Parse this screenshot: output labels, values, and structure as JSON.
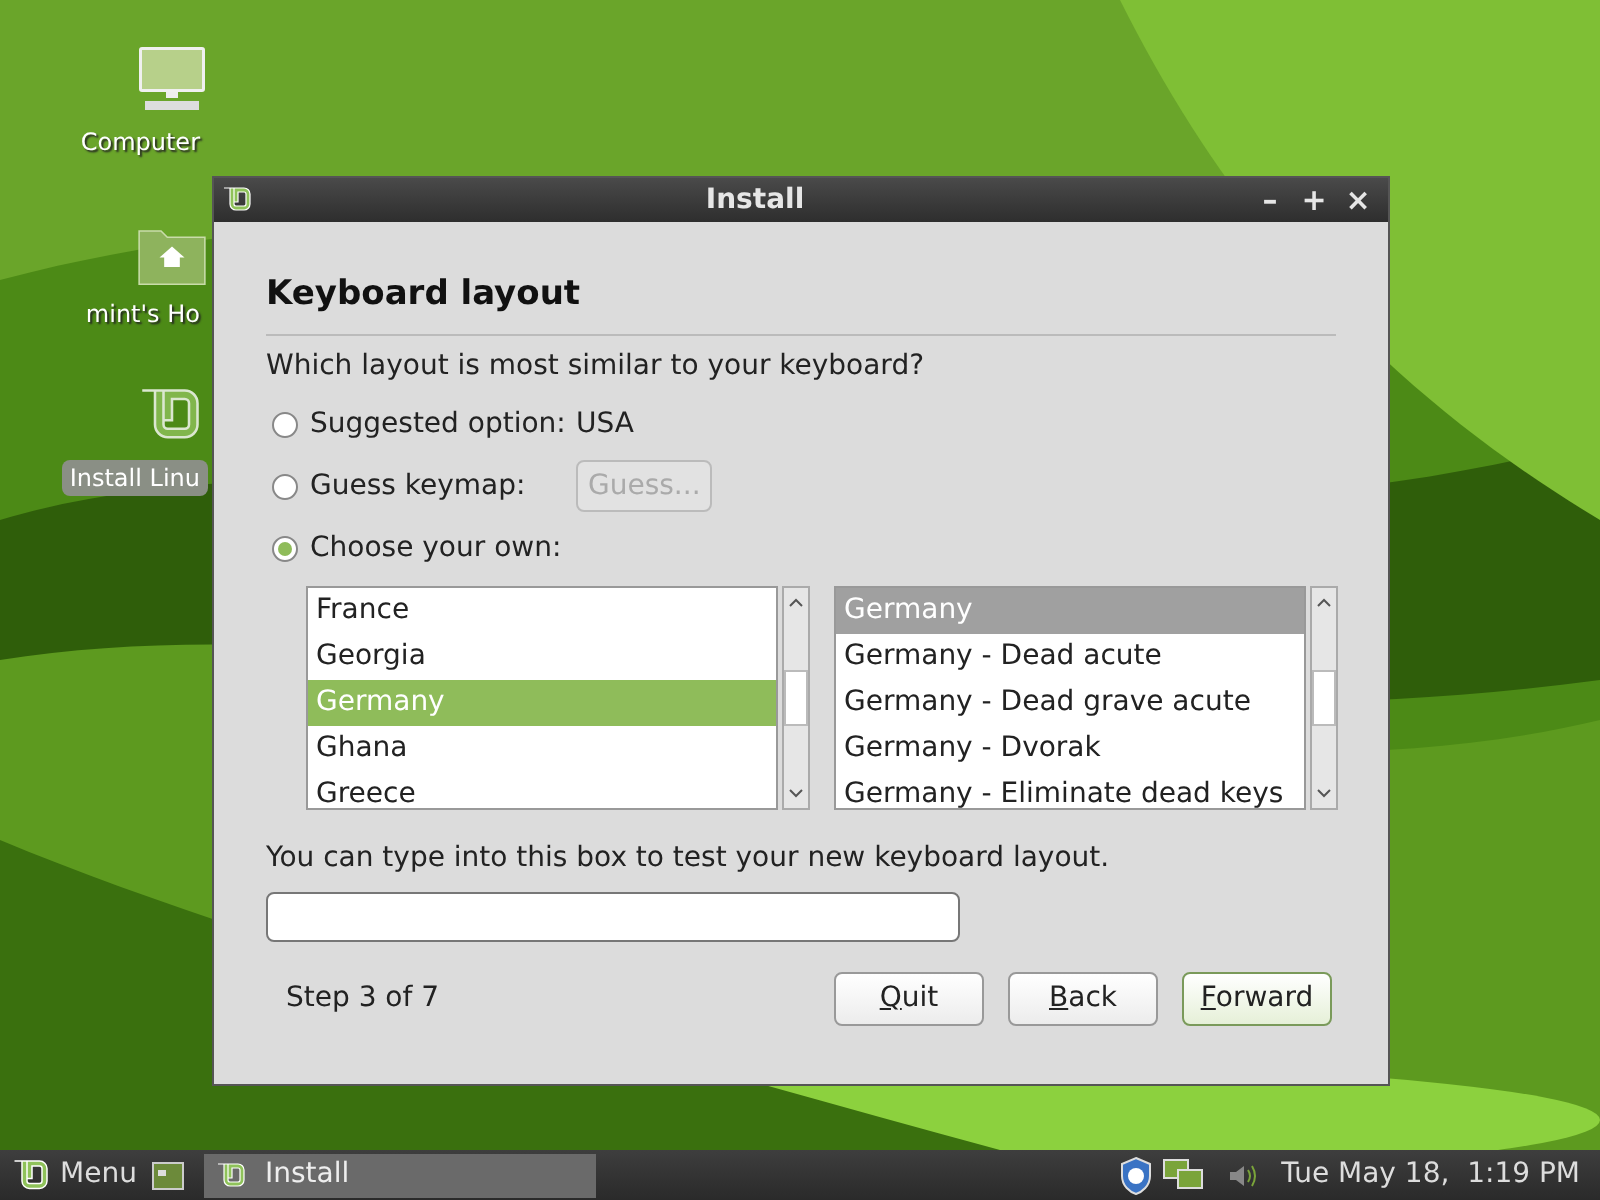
{
  "desktop_icons": [
    {
      "kind": "computer",
      "label": "Computer",
      "selected": false
    },
    {
      "kind": "home",
      "label": "mint's Ho",
      "selected": false
    },
    {
      "kind": "mint",
      "label": "Install Linu",
      "selected": true
    }
  ],
  "window": {
    "title": "Install",
    "controls": [
      "–",
      "+",
      "×"
    ]
  },
  "heading": "Keyboard layout",
  "question": "Which layout is most similar to your keyboard?",
  "options": [
    {
      "label": "Suggested option:",
      "kind": "value",
      "value": "USA",
      "selected": false
    },
    {
      "label": "Guess keymap:",
      "kind": "button",
      "button": "Guess...",
      "disabled": true,
      "selected": false
    },
    {
      "label": "Choose your own:",
      "kind": "plain",
      "selected": true
    }
  ],
  "layouts": {
    "items": [
      {
        "label": "France",
        "selected": false
      },
      {
        "label": "Georgia",
        "selected": false
      },
      {
        "label": "Germany",
        "selected": true
      },
      {
        "label": "Ghana",
        "selected": false
      },
      {
        "label": "Greece",
        "selected": false
      }
    ]
  },
  "variants": {
    "items": [
      {
        "label": "Germany",
        "selected": true
      },
      {
        "label": "Germany - Dead acute",
        "selected": false
      },
      {
        "label": "Germany - Dead grave acute",
        "selected": false
      },
      {
        "label": "Germany - Dvorak",
        "selected": false
      },
      {
        "label": "Germany - Eliminate dead keys",
        "selected": false
      }
    ]
  },
  "test_hint": "You can type into this box to test your new keyboard layout.",
  "step": "Step 3 of 7",
  "buttons": [
    {
      "label": "Quit",
      "default": false
    },
    {
      "label": "Back",
      "default": false
    },
    {
      "label": "Forward",
      "default": true
    }
  ],
  "taskbar": {
    "menu": "Menu",
    "tasks": [
      {
        "label": "Install",
        "selected": true
      }
    ],
    "clock": "Tue May 18,  1:19 PM"
  }
}
